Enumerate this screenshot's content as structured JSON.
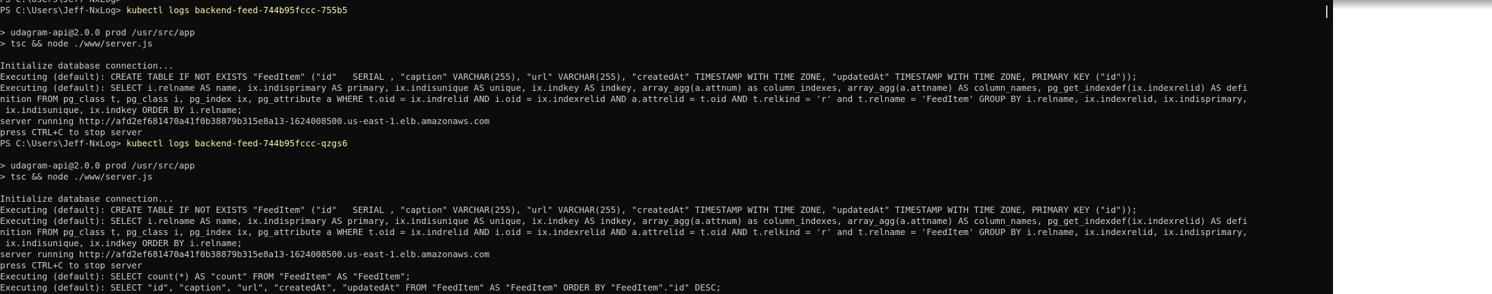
{
  "terminal": {
    "lines": [
      {
        "text": "PS C:\\Users\\Jeff-NxLog> ",
        "cmd": ""
      },
      {
        "text": "PS C:\\Users\\Jeff-NxLog> ",
        "cmd": "kubectl logs backend-feed-744b95fccc-755b5"
      },
      {
        "text": "",
        "cmd": ""
      },
      {
        "text": "> udagram-api@2.0.0 prod /usr/src/app",
        "cmd": ""
      },
      {
        "text": "> tsc && node ./www/server.js",
        "cmd": ""
      },
      {
        "text": "",
        "cmd": ""
      },
      {
        "text": "Initialize database connection...",
        "cmd": ""
      },
      {
        "text": "Executing (default): CREATE TABLE IF NOT EXISTS \"FeedItem\" (\"id\"   SERIAL , \"caption\" VARCHAR(255), \"url\" VARCHAR(255), \"createdAt\" TIMESTAMP WITH TIME ZONE, \"updatedAt\" TIMESTAMP WITH TIME ZONE, PRIMARY KEY (\"id\"));",
        "cmd": ""
      },
      {
        "text": "Executing (default): SELECT i.relname AS name, ix.indisprimary AS primary, ix.indisunique AS unique, ix.indkey AS indkey, array_agg(a.attnum) as column_indexes, array_agg(a.attname) AS column_names, pg_get_indexdef(ix.indexrelid) AS defi",
        "cmd": ""
      },
      {
        "text": "nition FROM pg_class t, pg_class i, pg_index ix, pg_attribute a WHERE t.oid = ix.indrelid AND i.oid = ix.indexrelid AND a.attrelid = t.oid AND t.relkind = 'r' and t.relname = 'FeedItem' GROUP BY i.relname, ix.indexrelid, ix.indisprimary,",
        "cmd": ""
      },
      {
        "text": " ix.indisunique, ix.indkey ORDER BY i.relname;",
        "cmd": ""
      },
      {
        "text": "server running http://afd2ef681470a41f0b38879b315e8a13-1624008500.us-east-1.elb.amazonaws.com",
        "cmd": ""
      },
      {
        "text": "press CTRL+C to stop server",
        "cmd": ""
      },
      {
        "text": "PS C:\\Users\\Jeff-NxLog> ",
        "cmd": "kubectl logs backend-feed-744b95fccc-qzgs6"
      },
      {
        "text": "",
        "cmd": ""
      },
      {
        "text": "> udagram-api@2.0.0 prod /usr/src/app",
        "cmd": ""
      },
      {
        "text": "> tsc && node ./www/server.js",
        "cmd": ""
      },
      {
        "text": "",
        "cmd": ""
      },
      {
        "text": "Initialize database connection...",
        "cmd": ""
      },
      {
        "text": "Executing (default): CREATE TABLE IF NOT EXISTS \"FeedItem\" (\"id\"   SERIAL , \"caption\" VARCHAR(255), \"url\" VARCHAR(255), \"createdAt\" TIMESTAMP WITH TIME ZONE, \"updatedAt\" TIMESTAMP WITH TIME ZONE, PRIMARY KEY (\"id\"));",
        "cmd": ""
      },
      {
        "text": "Executing (default): SELECT i.relname AS name, ix.indisprimary AS primary, ix.indisunique AS unique, ix.indkey AS indkey, array_agg(a.attnum) as column_indexes, array_agg(a.attname) AS column_names, pg_get_indexdef(ix.indexrelid) AS defi",
        "cmd": ""
      },
      {
        "text": "nition FROM pg_class t, pg_class i, pg_index ix, pg_attribute a WHERE t.oid = ix.indrelid AND i.oid = ix.indexrelid AND a.attrelid = t.oid AND t.relkind = 'r' and t.relname = 'FeedItem' GROUP BY i.relname, ix.indexrelid, ix.indisprimary,",
        "cmd": ""
      },
      {
        "text": " ix.indisunique, ix.indkey ORDER BY i.relname;",
        "cmd": ""
      },
      {
        "text": "server running http://afd2ef681470a41f0b38879b315e8a13-1624008500.us-east-1.elb.amazonaws.com",
        "cmd": ""
      },
      {
        "text": "press CTRL+C to stop server",
        "cmd": ""
      },
      {
        "text": "Executing (default): SELECT count(*) AS \"count\" FROM \"FeedItem\" AS \"FeedItem\";",
        "cmd": ""
      },
      {
        "text": "Executing (default): SELECT \"id\", \"caption\", \"url\", \"createdAt\", \"updatedAt\" FROM \"FeedItem\" AS \"FeedItem\" ORDER BY \"FeedItem\".\"id\" DESC;",
        "cmd": ""
      }
    ]
  },
  "colors": {
    "background": "#0c0c0c",
    "text": "#cccccc",
    "command": "#f9f1a5",
    "outside": "#ffffff"
  }
}
